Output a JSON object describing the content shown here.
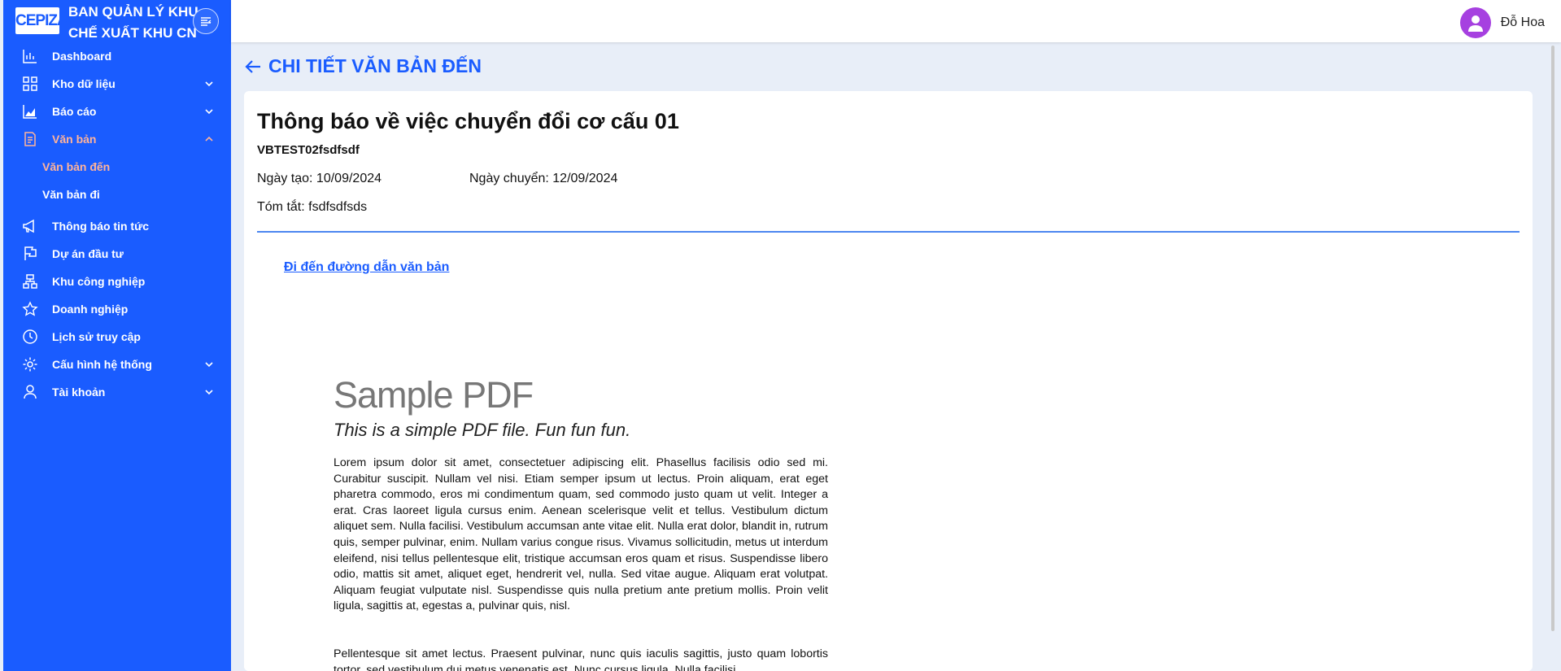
{
  "brand": {
    "logo_text": "CEPIZA",
    "name_line1": "BAN QUẢN LÝ KHU",
    "name_line2": "CHẾ XUẤT KHU CN"
  },
  "sidebar": {
    "items": [
      {
        "label": "Dashboard",
        "icon": "bar-chart-icon"
      },
      {
        "label": "Kho dữ liệu",
        "icon": "grid-icon"
      },
      {
        "label": "Báo cáo",
        "icon": "area-chart-icon"
      },
      {
        "label": "Văn bản",
        "icon": "document-icon"
      },
      {
        "label": "Thông báo tin tức",
        "icon": "megaphone-icon"
      },
      {
        "label": "Dự án đầu tư",
        "icon": "flag-icon"
      },
      {
        "label": "Khu công nghiệp",
        "icon": "sitemap-icon"
      },
      {
        "label": "Doanh nghiệp",
        "icon": "star-icon"
      },
      {
        "label": "Lịch sử truy cập",
        "icon": "history-icon"
      },
      {
        "label": "Cấu hình hệ thống",
        "icon": "gear-icon"
      },
      {
        "label": "Tài khoản",
        "icon": "user-icon"
      }
    ],
    "sub_items": [
      {
        "label": "Văn bản đến"
      },
      {
        "label": "Văn bản đi"
      }
    ]
  },
  "header": {
    "user_name": "Đỗ Hoa"
  },
  "page": {
    "title": "CHI TIẾT VĂN BẢN ĐẾN"
  },
  "document": {
    "title": "Thông báo về việc chuyển đổi cơ cấu 01",
    "code": "VBTEST02fsdfsdf",
    "created": "Ngày tạo: 10/09/2024",
    "sent": "Ngày chuyển: 12/09/2024",
    "summary": "Tóm tắt: fsdfsdfsds",
    "link_text": "Đi đến đường dẫn văn bản"
  },
  "pdf": {
    "heading": "Sample PDF",
    "subheading": "This is a simple PDF file. Fun fun fun.",
    "paragraph1": "Lorem ipsum dolor sit amet, consectetuer adipiscing elit. Phasellus facilisis odio sed mi. Curabitur suscipit. Nullam vel nisi. Etiam semper ipsum ut lectus. Proin aliquam, erat eget pharetra commodo, eros mi condimentum quam, sed commodo justo quam ut velit. Integer a erat. Cras laoreet ligula cursus enim. Aenean scelerisque velit et tellus. Vestibulum dictum aliquet sem. Nulla facilisi. Vestibulum accumsan ante vitae elit. Nulla erat dolor, blandit in, rutrum quis, semper pulvinar, enim. Nullam varius congue risus. Vivamus sollicitudin, metus ut interdum eleifend, nisi tellus pellentesque elit, tristique accumsan eros quam et risus. Suspendisse libero odio, mattis sit amet, aliquet eget, hendrerit vel, nulla. Sed vitae augue. Aliquam erat volutpat. Aliquam feugiat vulputate nisl. Suspendisse quis nulla pretium ante pretium mollis. Proin velit ligula, sagittis at, egestas a, pulvinar quis, nisl.",
    "paragraph2": "Pellentesque sit amet lectus. Praesent pulvinar, nunc quis iaculis sagittis, justo quam lobortis tortor, sed vestibulum dui metus venenatis est. Nunc cursus ligula. Nulla facilisi."
  },
  "colors": {
    "sidebar_bg": "#1a5cff",
    "active_text": "#ffb39a",
    "accent": "#1a5cff",
    "avatar_bg": "#a640e0"
  }
}
